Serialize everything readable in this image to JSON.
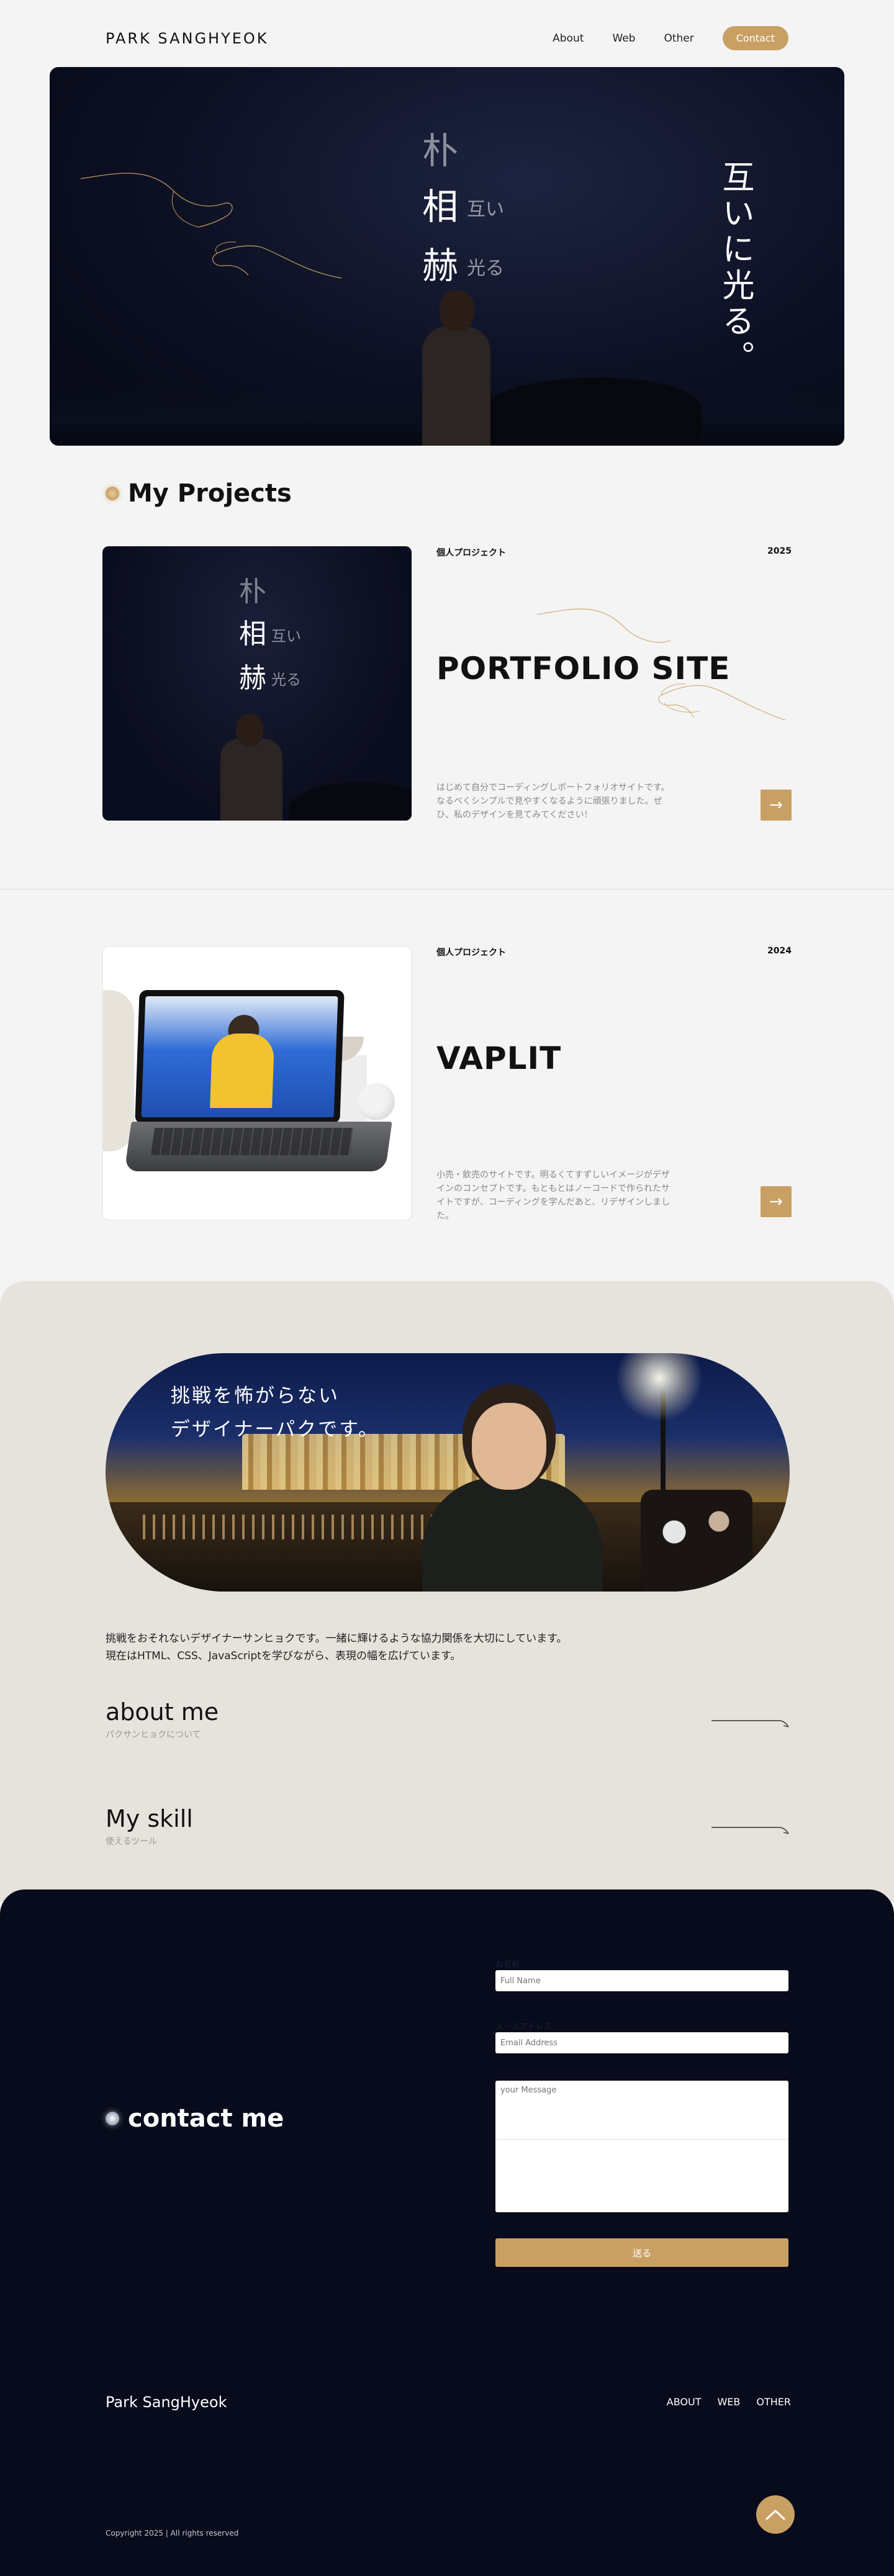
{
  "header": {
    "logo": "PARK SANGHYEOK",
    "nav": [
      "About",
      "Web",
      "Other"
    ],
    "contact_button": "Contact"
  },
  "hero": {
    "kanji": [
      "朴",
      "相",
      "赫"
    ],
    "kanji_small": [
      "互い",
      "光る"
    ],
    "tagline": "互いに光る。"
  },
  "projects_section": {
    "title": "My Projects"
  },
  "projects": [
    {
      "tag": "個人プロジェクト",
      "year": "2025",
      "name": "PORTFOLIO SITE",
      "desc": "はじめて自分でコーディングしポートフォリオサイトです。なるべくシンプルで見やすくなるように頑張りました。ぜひ、私のデザインを見てみてください！",
      "thumb_kanji": [
        "朴",
        "相",
        "赫"
      ],
      "thumb_kanji_small": [
        "互い",
        "光る"
      ],
      "arrow": "→"
    },
    {
      "tag": "個人プロジェクト",
      "year": "2024",
      "name": "VAPLIT",
      "desc": "小売・飲売のサイトです。明るくてすずしいイメージがデザインのコンセプトです。もともとはノーコードで作られたサイトですが、コーディングを学んだあと、リデザインしました。",
      "arrow": "→"
    }
  ],
  "about": {
    "catch_lines": [
      "挑戦を怖がらない",
      "デザイナーパクです。"
    ],
    "intro_lines": [
      "挑戦をおそれないデザイナーサンヒョクです。一緒に輝けるような協力関係を大切にしています。",
      "現在はHTML、CSS、JavaScriptを学びながら、表現の幅を広げています。"
    ],
    "links": [
      {
        "title": "about me",
        "sub": "パクサンヒョクについて"
      },
      {
        "title": "My skill",
        "sub": "使えるツール"
      }
    ]
  },
  "contact": {
    "title": "contact me",
    "name_label": "お名前",
    "name_placeholder": "Full Name",
    "email_label": "メールアドレス",
    "email_placeholder": "Email Address",
    "message_placeholder": "your Message",
    "submit": "送る"
  },
  "footer": {
    "name": "Park SangHyeok",
    "nav": [
      "ABOUT",
      "WEB",
      "OTHER"
    ],
    "copyright": "Copyright 2025 | All rights reserved"
  },
  "colors": {
    "accent": "#c9a064",
    "contact_bg": "#070b1b",
    "about_bg": "#e6e2dc",
    "page_bg": "#f4f4f4"
  }
}
